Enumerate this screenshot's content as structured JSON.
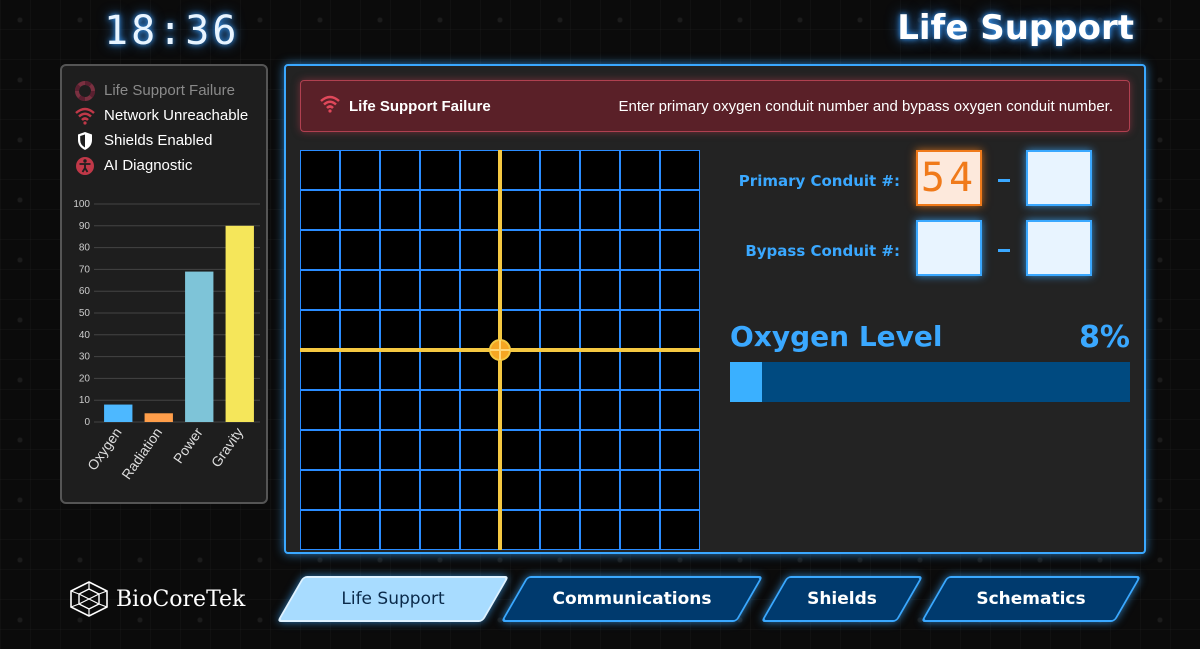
{
  "header": {
    "clock": "18:36",
    "title": "Life Support"
  },
  "status": {
    "items": [
      {
        "label": "Life Support Failure",
        "icon": "life-ring-icon",
        "dim": true
      },
      {
        "label": "Network Unreachable",
        "icon": "wifi-icon",
        "dim": false
      },
      {
        "label": "Shields Enabled",
        "icon": "shield-icon",
        "dim": false
      },
      {
        "label": "AI Diagnostic",
        "icon": "accessibility-icon",
        "dim": false
      }
    ]
  },
  "chart_data": {
    "type": "bar",
    "categories": [
      "Oxygen",
      "Radiation",
      "Power",
      "Gravity"
    ],
    "values": [
      8,
      4,
      69,
      90
    ],
    "colors": [
      "#4db8ff",
      "#ff9e4a",
      "#7ec4d8",
      "#f5e65a"
    ],
    "ylim": [
      0,
      100
    ],
    "yticks": [
      0,
      10,
      20,
      30,
      40,
      50,
      60,
      70,
      80,
      90,
      100
    ]
  },
  "alert": {
    "title": "Life Support Failure",
    "message": "Enter primary oxygen conduit number and bypass oxygen conduit number."
  },
  "conduits": {
    "primary_label": "Primary Conduit #:",
    "bypass_label": "Bypass Conduit #:",
    "primary_first": "54",
    "primary_second": "",
    "bypass_first": "",
    "bypass_second": ""
  },
  "oxygen": {
    "label": "Oxygen Level",
    "value_text": "8%",
    "level": 0.08
  },
  "brand": {
    "name": "BioCoreTek"
  },
  "tabs": [
    {
      "label": "Life Support",
      "active": true
    },
    {
      "label": "Communications",
      "active": false
    },
    {
      "label": "Shields",
      "active": false
    },
    {
      "label": "Schematics",
      "active": false
    }
  ],
  "colors": {
    "accent": "#3aa8ff",
    "alert": "#b04050",
    "crosshair": "#f5c842"
  }
}
